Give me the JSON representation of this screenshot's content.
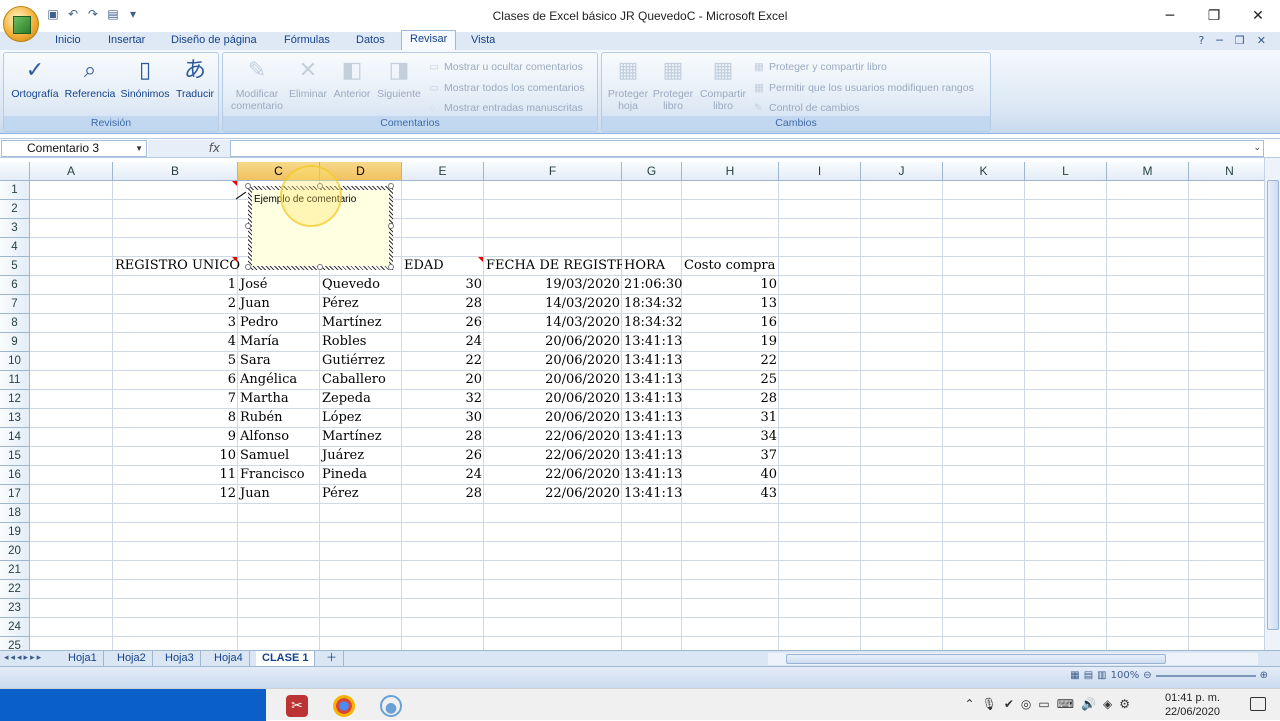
{
  "window": {
    "title": "Clases de Excel básico JR QuevedoC - Microsoft Excel"
  },
  "ribbon_tabs": [
    "Inicio",
    "Insertar",
    "Diseño de página",
    "Fórmulas",
    "Datos",
    "Revisar",
    "Vista"
  ],
  "active_tab": "Revisar",
  "groups": {
    "revision": {
      "label": "Revisión",
      "buttons": [
        "Ortografía",
        "Referencia",
        "Sinónimos",
        "Traducir"
      ]
    },
    "comentarios": {
      "label": "Comentarios",
      "big": [
        [
          "Modificar",
          "comentario"
        ],
        [
          "Eliminar",
          ""
        ],
        [
          "Anterior",
          ""
        ],
        [
          "Siguiente",
          ""
        ]
      ],
      "small": [
        "Mostrar u ocultar comentarios",
        "Mostrar todos los comentarios",
        "Mostrar entradas manuscritas"
      ]
    },
    "cambios": {
      "label": "Cambios",
      "big": [
        [
          "Proteger",
          "hoja"
        ],
        [
          "Proteger",
          "libro"
        ],
        [
          "Compartir",
          "libro"
        ]
      ],
      "small": [
        "Proteger y compartir libro",
        "Permitir que los usuarios modifiquen rangos",
        "Control de cambios"
      ]
    }
  },
  "namebox": "Comentario 3",
  "fx": "fx",
  "columns": [
    "A",
    "B",
    "C",
    "D",
    "E",
    "F",
    "G",
    "H",
    "I",
    "J",
    "K",
    "L",
    "M",
    "N"
  ],
  "rows": [
    "1",
    "2",
    "3",
    "4",
    "5",
    "6",
    "7",
    "8",
    "9",
    "10",
    "11",
    "12",
    "13",
    "14",
    "15",
    "16",
    "17",
    "18",
    "19",
    "20",
    "21",
    "22",
    "23",
    "24",
    "25"
  ],
  "headers": {
    "b": "REGISTRO UNICO",
    "e": "EDAD",
    "f": "FECHA DE REGISTRO",
    "g": "HORA",
    "h": "Costo compra"
  },
  "data": [
    [
      "1",
      "José",
      "Quevedo",
      "30",
      "19/03/2020",
      "21:06:30",
      "10"
    ],
    [
      "2",
      "Juan",
      "Pérez",
      "28",
      "14/03/2020",
      "18:34:32",
      "13"
    ],
    [
      "3",
      "Pedro",
      "Martínez",
      "26",
      "14/03/2020",
      "18:34:32",
      "16"
    ],
    [
      "4",
      "María",
      "Robles",
      "24",
      "20/06/2020",
      "13:41:13",
      "19"
    ],
    [
      "5",
      "Sara",
      "Gutiérrez",
      "22",
      "20/06/2020",
      "13:41:13",
      "22"
    ],
    [
      "6",
      "Angélica",
      "Caballero",
      "20",
      "20/06/2020",
      "13:41:13",
      "25"
    ],
    [
      "7",
      "Martha",
      "Zepeda",
      "32",
      "20/06/2020",
      "13:41:13",
      "28"
    ],
    [
      "8",
      "Rubén",
      "López",
      "30",
      "20/06/2020",
      "13:41:13",
      "31"
    ],
    [
      "9",
      "Alfonso",
      "Martínez",
      "28",
      "22/06/2020",
      "13:41:13",
      "34"
    ],
    [
      "10",
      "Samuel",
      "Juárez",
      "26",
      "22/06/2020",
      "13:41:13",
      "37"
    ],
    [
      "11",
      "Francisco",
      "Pineda",
      "24",
      "22/06/2020",
      "13:41:13",
      "40"
    ],
    [
      "12",
      "Juan",
      "Pérez",
      "28",
      "22/06/2020",
      "13:41:13",
      "43"
    ]
  ],
  "comment_text": "Ejemplo de comentario",
  "sheets": [
    "Hoja1",
    "Hoja2",
    "Hoja3",
    "Hoja4",
    "CLASE 1"
  ],
  "active_sheet": "CLASE 1",
  "zoom": "100%",
  "clock": {
    "time": "01:41 p. m.",
    "date": "22/06/2020"
  }
}
